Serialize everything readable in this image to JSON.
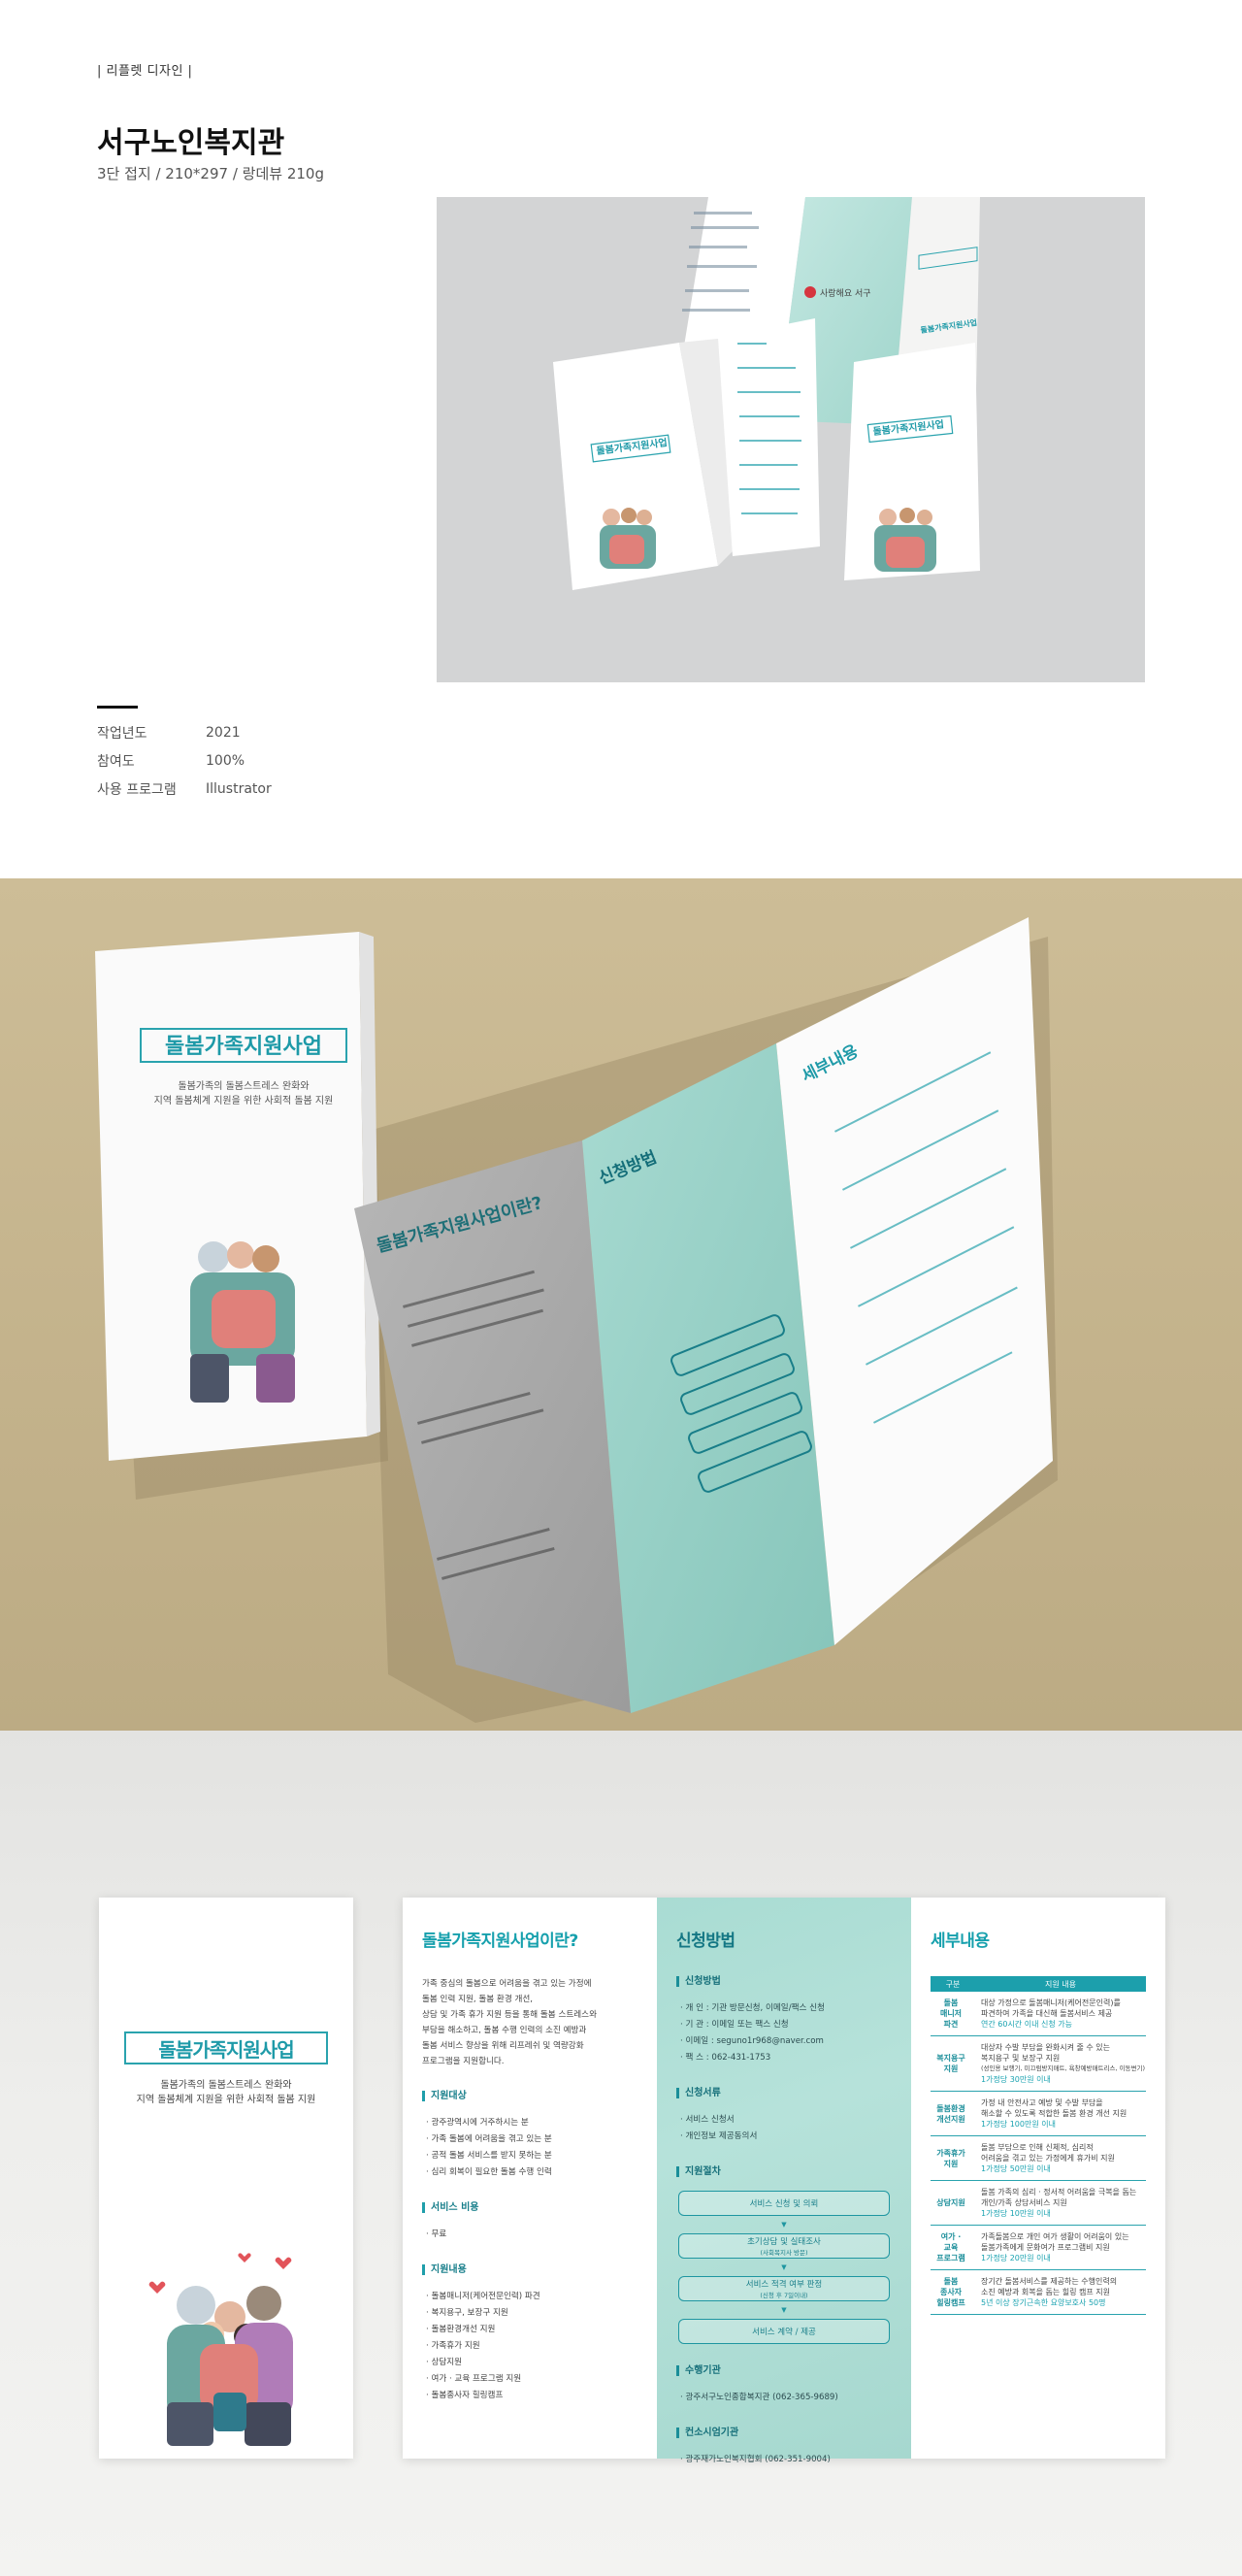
{
  "header": {
    "category": "| 리플렛 디자인 |",
    "title": "서구노인복지관",
    "subtitle": "3단 접지 / 210*297 / 랑데뷰 210g"
  },
  "info": [
    {
      "label": "작업년도",
      "value": "2021"
    },
    {
      "label": "참여도",
      "value": "100%"
    },
    {
      "label": "사용 프로그램",
      "value": "Illustrator"
    }
  ],
  "cover": {
    "title": "돌봄가족지원사업",
    "subtitle_lines": [
      "돌봄가족의 돌봄스트레스 완화와",
      "지역 돌봄체계 지원을 위한 사회적 돌봄 지원"
    ]
  },
  "panel_intro": {
    "heading": "돌봄가족지원사업이란?",
    "body_lines": [
      "가족 중심의 돌봄으로 어려움을 겪고 있는 가정에",
      "돌봄 인력 지원, 돌봄 환경 개선,",
      "상담 및 가족 휴가 지원 등을 통해 돌봄 스트레스와",
      "부담을 해소하고, 돌봄 수행 인력의 소진 예방과",
      "돌봄 서비스 향상을 위해 리프레쉬 및 역량강화",
      "프로그램을 지원합니다."
    ],
    "target_heading": "지원대상",
    "target_items": [
      "· 광주광역시에 거주하시는 분",
      "· 가족 돌봄에 어려움을 겪고 있는 분",
      "· 공적 돌봄 서비스를 받지 못하는 분",
      "· 심리 회복이 필요한 돌봄 수행 인력"
    ],
    "cost_heading": "서비스 비용",
    "cost_items": [
      "· 무료"
    ],
    "content_heading": "지원내용",
    "content_items": [
      "· 돌봄매니저(케어전문인력) 파견",
      "· 복지용구, 보장구 지원",
      "· 돌봄환경개선 지원",
      "· 가족휴가 지원",
      "· 상담지원",
      "· 여가 · 교육 프로그램 지원",
      "· 돌봄종사자 힐링캠프"
    ]
  },
  "panel_apply": {
    "heading": "신청방법",
    "method_heading": "신청방법",
    "method_items": [
      "· 개   인 : 기관 방문신청, 이메일/팩스 신청",
      "· 기   관 : 이메일 또는 팩스 신청",
      "· 이메일 : seguno1r968@naver.com",
      "· 팩   스 : 062-431-1753"
    ],
    "docs_heading": "신청서류",
    "docs_items": [
      "· 서비스 신청서",
      "· 개인정보 제공동의서"
    ],
    "process_heading": "지원절차",
    "process_steps": [
      {
        "label": "서비스 신청 및 의뢰",
        "note": ""
      },
      {
        "label": "초기상담 및 실태조사",
        "note": "(사회복지사 방문)"
      },
      {
        "label": "서비스 적격 여부 판정",
        "note": "(신청 후 7일이내)"
      },
      {
        "label": "서비스 계약 / 제공",
        "note": ""
      }
    ],
    "agency_heading": "수행기관",
    "agency_items": [
      "· 광주서구노인종합복지관 (062-365-9689)"
    ],
    "assoc_heading": "컨소시엄기관",
    "assoc_items": [
      "· 광주재가노인복지협회 (062-351-9004)"
    ]
  },
  "panel_detail": {
    "heading": "세부내용",
    "table_headers": [
      "구분",
      "지원 내용"
    ],
    "rows": [
      {
        "key": [
          "돌봄",
          "매니저",
          "파견"
        ],
        "lines": [
          "대상 가정으로 돌봄매니저(케어전문인력)를",
          "파견하여 가족을 대신해 돌봄서비스 제공"
        ],
        "highlight": "연간 60시간 이내 신청 가능"
      },
      {
        "key": [
          "복지용구",
          "지원"
        ],
        "lines": [
          "대상자 수발 부담을 완화시켜 줄 수 있는",
          "복지용구 및 보장구 지원",
          "(성인용 보행기, 미끄럼방지매트, 욕창예방매트리스, 이동변기)"
        ],
        "highlight": "1가정당 30만원 이내"
      },
      {
        "key": [
          "돌봄환경",
          "개선지원"
        ],
        "lines": [
          "가정 내 안전사고 예방 및 수발 부담을",
          "해소할 수 있도록 적합한 돌봄 환경 개선 지원"
        ],
        "highlight": "1가정당 100만원 이내"
      },
      {
        "key": [
          "가족휴가",
          "지원"
        ],
        "lines": [
          "돌봄 부담으로 인해 신체적, 심리적",
          "어려움을 겪고 있는 가정에게 휴가비 지원"
        ],
        "highlight": "1가정당 50만원 이내"
      },
      {
        "key": [
          "상담지원"
        ],
        "lines": [
          "돌봄 가족의 심리 · 정서적 어려움을 극복을 돕는",
          "개인/가족 상담서비스 지원"
        ],
        "highlight": "1가정당 10만원 이내"
      },
      {
        "key": [
          "여가 ·",
          "교육",
          "프로그램"
        ],
        "lines": [
          "가족돌봄으로 개인 여가 생활이 어려움이 있는",
          "돌봄가족에게 문화여가 프로그램비 지원"
        ],
        "highlight": "1가정당 20만원 이내"
      },
      {
        "key": [
          "돌봄",
          "종사자",
          "힐링캠프"
        ],
        "lines": [
          "장기간 돌봄서비스를 제공하는 수행인력의",
          "소진 예방과 회복을 돕는 힐링 캠프 지원"
        ],
        "highlight": "5년 이상 장기근속한 요양보호사 50명"
      }
    ]
  },
  "mock1_texts": {
    "a": "돌봄가족지원사업",
    "b": "돌봄가족지원사업",
    "c": "돌봄가족지원사업",
    "d": "사랑해요 서구"
  },
  "mock2_texts": {
    "cover": "돌봄가족지원사업",
    "cover_sub1": "돌봄가족의 돌봄스트레스 완화와",
    "cover_sub2": "지역 돌봄체계 지원을 위한 사회적 돌봄 지원",
    "p1": "돌봄가족지원사업이란?",
    "p2": "신청방법",
    "p3": "세부내용"
  },
  "colors": {
    "teal": "#1e9aa8",
    "teal_light": "#a9dcd3",
    "grey_panel": "#a9a9a9",
    "kraft": "#c6b58e",
    "mockup_grey": "#d3d4d5"
  }
}
